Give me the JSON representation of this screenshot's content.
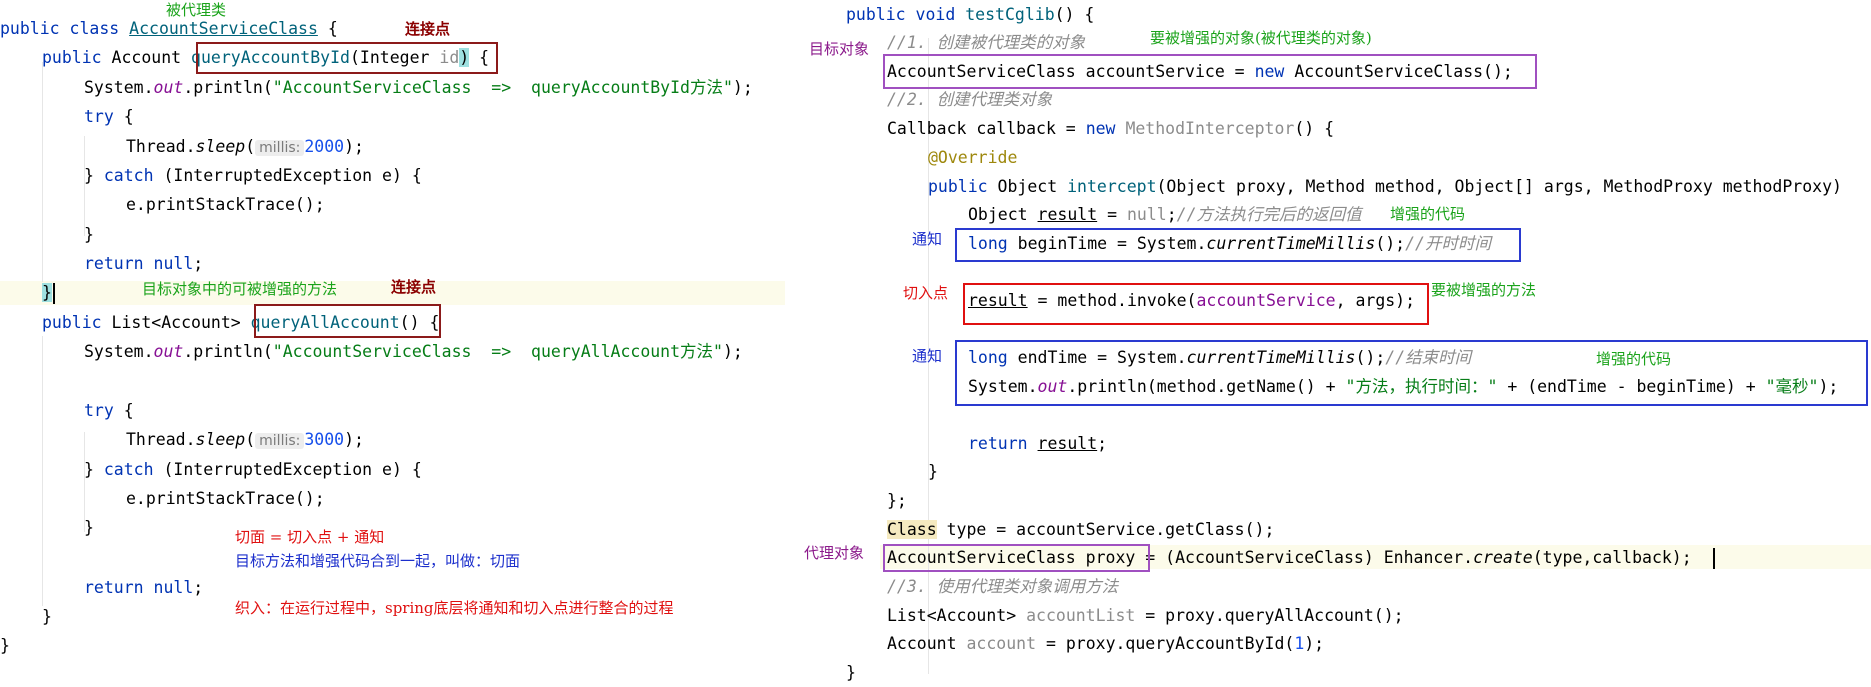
{
  "left": {
    "lines": {
      "l1": {
        "a": "public class ",
        "b": "AccountServiceClass",
        "c": " {"
      },
      "l2": {
        "a": "public ",
        "b": "Account ",
        "c": "queryAccountById",
        "d": "(Integer ",
        "e": "id",
        "f": ")",
        "g": " {"
      },
      "l3": {
        "a": "System.",
        "b": "out",
        "c": ".println(",
        "d": "\"AccountServiceClass  =>  queryAccountById方法\"",
        "e": ");"
      },
      "l4": {
        "a": "try",
        "b": " {"
      },
      "l5": {
        "a": "Thread.",
        "b": "sleep",
        "c": "(",
        "hint": "millis:",
        "d": "2000",
        "e": ");"
      },
      "l6": {
        "a": "} ",
        "b": "catch",
        "c": " (InterruptedException e) {"
      },
      "l7": {
        "a": "e.printStackTrace();"
      },
      "l8": {
        "a": "}"
      },
      "l9": {
        "a": "return null",
        "b": ";"
      },
      "l10": {
        "a": "}"
      },
      "l11": {
        "a": "public ",
        "b": "List<Account> ",
        "c": "queryAllAccount",
        "d": "()",
        "e": " {"
      },
      "l12": {
        "a": "System.",
        "b": "out",
        "c": ".println(",
        "d": "\"AccountServiceClass  =>  queryAllAccount方法\"",
        "e": ");"
      },
      "l13": {
        "a": "try",
        "b": " {"
      },
      "l14": {
        "a": "Thread.",
        "b": "sleep",
        "c": "(",
        "hint": "millis:",
        "d": "3000",
        "e": ");"
      },
      "l15": {
        "a": "} ",
        "b": "catch",
        "c": " (InterruptedException e) {"
      },
      "l16": {
        "a": "e.printStackTrace();"
      },
      "l17": {
        "a": "}"
      },
      "l18": {
        "a": "return null",
        "b": ";"
      },
      "l19": {
        "a": "}"
      },
      "l20": {
        "a": "}"
      }
    },
    "notes": {
      "proxied_class": "被代理类",
      "joinpoint_1": "连接点",
      "enhanceable_method": "目标对象中的可被增强的方法",
      "joinpoint_2": "连接点",
      "aspect_formula": "切面 = 切入点 + 通知",
      "aspect_desc": "目标方法和增强代码合到一起，叫做：切面",
      "weaving": "织入：在运行过程中，spring底层将通知和切入点进行整合的过程"
    }
  },
  "right": {
    "lines": {
      "r1": {
        "a": "public void ",
        "b": "testCglib",
        "c": "() {"
      },
      "r2": {
        "a": "//1. 创建被代理类的对象"
      },
      "r3": {
        "a": "AccountServiceClass accountService = ",
        "b": "new ",
        "c": "AccountServiceClass();"
      },
      "r4": {
        "a": "//2. 创建代理类对象"
      },
      "r5": {
        "a": "Callback callback = ",
        "b": "new ",
        "c": "MethodInterceptor",
        "d": "() {"
      },
      "r6": {
        "a": "@Override"
      },
      "r7": {
        "a": "public ",
        "b": "Object ",
        "c": "intercept",
        "d": "(Object proxy, Method method, Object[] args, MethodProxy methodProxy)"
      },
      "r8": {
        "a": "Object ",
        "b": "result",
        "c": " = ",
        "d": "null",
        "e": ";",
        "f": "//方法执行完后的返回值"
      },
      "r9": {
        "a": "long ",
        "b": "beginTime = System.",
        "c": "currentTimeMillis",
        "d": "();",
        "e": "//开时时间"
      },
      "r10": {
        "a": "result",
        "b": " = method.invoke(",
        "c": "accountService",
        "d": ", args);"
      },
      "r11": {
        "a": "long ",
        "b": "endTime = System.",
        "c": "currentTimeMillis",
        "d": "();",
        "e": "//结束时间"
      },
      "r12": {
        "a": "System.",
        "b": "out",
        "c": ".println(method.getName() + ",
        "d": "\"方法，执行时间：\"",
        "e": " + (endTime - beginTime) + ",
        "f": "\"毫秒\"",
        "g": ");"
      },
      "r13": {
        "a": "return ",
        "b": "result",
        "c": ";"
      },
      "r14": {
        "a": "}"
      },
      "r15": {
        "a": "};"
      },
      "r16": {
        "a": "Class",
        "b": " type = accountService.getClass();"
      },
      "r17": {
        "a": "AccountServiceClass proxy",
        "b": " = (AccountServiceClass) Enhancer.",
        "c": "create",
        "d": "(type,callback);"
      },
      "r18": {
        "a": "//3. 使用代理类对象调用方法"
      },
      "r19": {
        "a": "List<Account> ",
        "b": "accountList",
        "c": " = proxy.queryAllAccount();"
      },
      "r20": {
        "a": "Account ",
        "b": "account",
        "c": " = proxy.queryAccountById(",
        "d": "1",
        "e": ");"
      },
      "r21": {
        "a": "}"
      }
    },
    "notes": {
      "target_object": "目标对象",
      "enhanced_object": "要被增强的对象(被代理类的对象)",
      "enhancement_code_1": "增强的代码",
      "advice_1": "通知",
      "pointcut": "切入点",
      "method_to_enhance": "要被增强的方法",
      "advice_2": "通知",
      "enhancement_code_2": "增强的代码",
      "proxy_object": "代理对象"
    }
  },
  "colors": {
    "keyword": "#0033b3",
    "string": "#067d17",
    "number": "#1750eb",
    "comment": "#8c8c8c",
    "field": "#871094",
    "function": "#00627a",
    "annotation": "#9e880d",
    "note_green": "#1aa31a",
    "note_dark_red": "#8b0000",
    "note_red": "#e01010",
    "note_blue": "#1c2fcc",
    "note_purple": "#8b1a8b"
  }
}
